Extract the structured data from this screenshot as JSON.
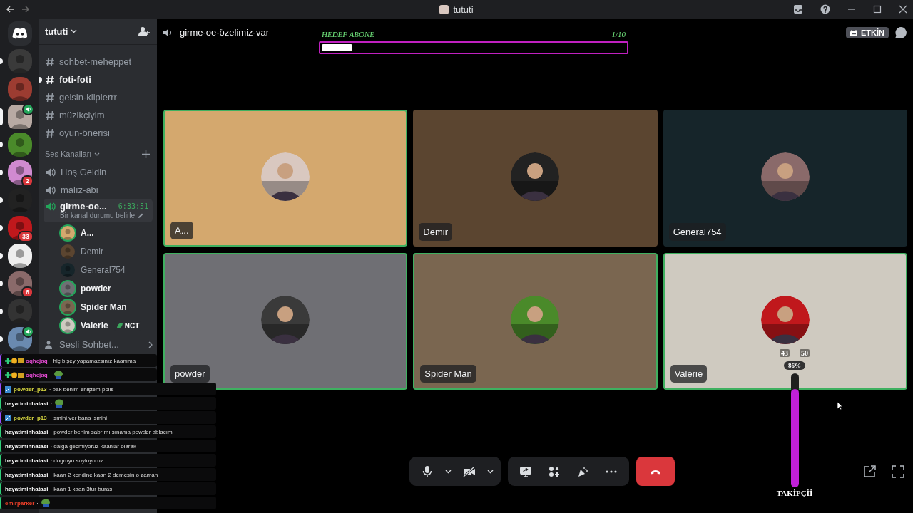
{
  "titlebar": {
    "title": "tututi"
  },
  "servers": [
    {
      "unread": true,
      "selected": false,
      "speaker": false
    },
    {
      "unread": false,
      "selected": false,
      "speaker": false
    },
    {
      "unread": false,
      "selected": true,
      "speaker": true
    },
    {
      "unread": true,
      "selected": false,
      "speaker": false
    },
    {
      "unread": true,
      "selected": false,
      "badge": "2",
      "speaker": false
    },
    {
      "unread": true,
      "selected": false,
      "speaker": false
    },
    {
      "unread": true,
      "selected": false,
      "badge": "33",
      "speaker": false
    },
    {
      "unread": true,
      "selected": false,
      "speaker": false
    },
    {
      "unread": true,
      "selected": false,
      "badge": "6",
      "speaker": false
    },
    {
      "unread": true,
      "selected": false,
      "speaker": false
    },
    {
      "unread": true,
      "selected": false,
      "speaker": true
    }
  ],
  "sidebar": {
    "server_name": "tututi",
    "text_channels": [
      {
        "name": "sohbet-meheppet",
        "selected": false,
        "unread": false
      },
      {
        "name": "foti-foti",
        "selected": false,
        "unread": true
      },
      {
        "name": "gelsin-kliplerrr",
        "selected": false,
        "unread": false
      },
      {
        "name": "müzikçiyim",
        "selected": false,
        "unread": false
      },
      {
        "name": "oyun-önerisi",
        "selected": false,
        "unread": false
      }
    ],
    "voice_header": "Ses Kanalları",
    "voice_channels": [
      {
        "name": "Hoş Geldin"
      },
      {
        "name": "malız-abi"
      }
    ],
    "active_voice": {
      "name": "girme-oe...",
      "timer": "6:33:51",
      "status": "Bir kanal durumu belirle",
      "members": [
        {
          "name": "A...",
          "speaking": true
        },
        {
          "name": "Demir",
          "speaking": false
        },
        {
          "name": "General754",
          "speaking": false
        },
        {
          "name": "powder",
          "speaking": true
        },
        {
          "name": "Spider Man",
          "speaking": true
        },
        {
          "name": "Valerie",
          "speaking": true,
          "badge": "NCT"
        }
      ]
    },
    "more": "Sesli Sohbet..."
  },
  "call": {
    "channel": "girme-oe-özelimiz-var",
    "goal": {
      "label": "HEDEF ABONE",
      "count": "1/10",
      "level": 0.1
    },
    "activity": "ETKİN",
    "tiles": [
      {
        "name": "A...",
        "color": "#d4a86e",
        "speaking": true
      },
      {
        "name": "Demir",
        "color": "#5b4530",
        "speaking": false
      },
      {
        "name": "General754",
        "color": "#16252a",
        "speaking": false
      },
      {
        "name": "powder",
        "color": "#6f6f74",
        "speaking": true
      },
      {
        "name": "Spider Man",
        "color": "#7a6650",
        "speaking": true
      },
      {
        "name": "Valerie",
        "color": "#cfcac0",
        "speaking": true
      }
    ],
    "meter": {
      "marks": [
        "43",
        "50"
      ],
      "percent": "86%",
      "level": 0.86,
      "label": "TAKİPÇİİ"
    }
  },
  "chat": [
    {
      "kind": "vip",
      "user": "oqhejaq",
      "color": "#e04ad0",
      "text": "· hiç bişey yapamazsınız kaanıma",
      "emote": false
    },
    {
      "kind": "vip",
      "user": "oqhejaq",
      "color": "#e04ad0",
      "text": "·",
      "emote": true
    },
    {
      "kind": "sub",
      "user": "powder_p13",
      "color": "#d6d640",
      "text": "· bak benim eniştem polis",
      "emote": false
    },
    {
      "kind": "regular",
      "user": "hayatiminhatasi",
      "color": "#ffffff",
      "text": "·",
      "emote": true
    },
    {
      "kind": "sub",
      "user": "powder_p13",
      "color": "#d6d640",
      "text": "· ismini ver bana ismini",
      "emote": false
    },
    {
      "kind": "regular",
      "user": "hayatiminhatasi",
      "color": "#ffffff",
      "text": "· powder benim sabrımı sınama powder ablacım",
      "emote": false
    },
    {
      "kind": "regular",
      "user": "hayatiminhatasi",
      "color": "#ffffff",
      "text": "· dalga gecmıyoruz kaanlar olarak",
      "emote": false
    },
    {
      "kind": "regular",
      "user": "hayatiminhatasi",
      "color": "#ffffff",
      "text": "· dogruyu soyluyoruz",
      "emote": false
    },
    {
      "kind": "regular",
      "user": "hayatiminhatasi",
      "color": "#ffffff",
      "text": "· kaan 2 kendine kaan 2 demesin o zaman",
      "emote": false
    },
    {
      "kind": "regular",
      "user": "hayatiminhatasi",
      "color": "#ffffff",
      "text": "· kaan 1 kaan 3tur burası",
      "emote": false
    },
    {
      "kind": "regular",
      "user": "emirparker",
      "color": "#f0402a",
      "text": "·",
      "emote": true
    }
  ]
}
